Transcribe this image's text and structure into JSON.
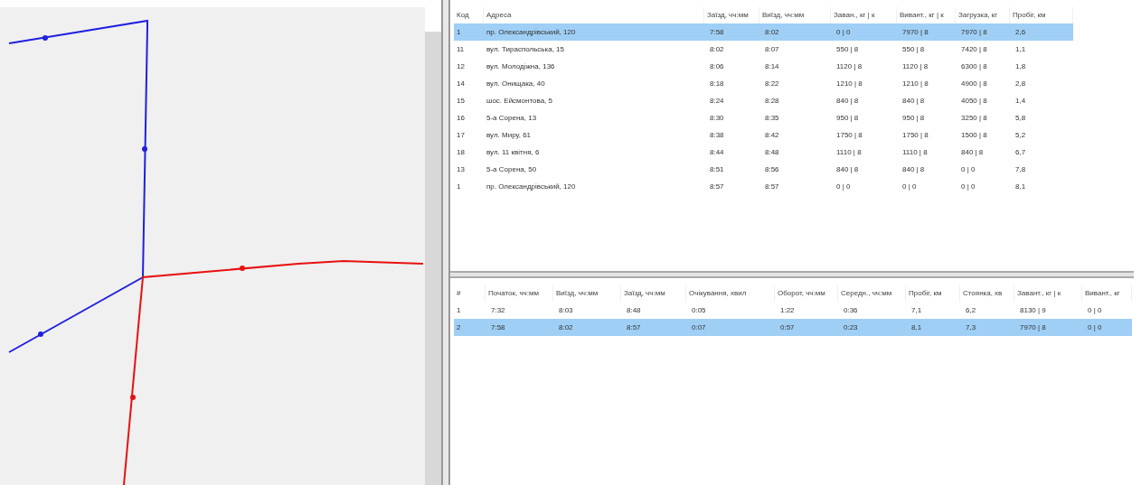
{
  "map": {
    "routes": [
      {
        "color": "#2020e0"
      },
      {
        "color": "#e81010"
      }
    ]
  },
  "stops_table": {
    "columns": [
      "Код",
      "Адреса",
      "Заїзд, чч:мм",
      "Виїзд, чч:мм",
      "Заван., кг | к",
      "Вивант., кг | к",
      "Загрузка, кг",
      "Пробіг, км"
    ],
    "rows": [
      {
        "cells": [
          "1",
          "пр. Олександрівський, 120",
          "7:58",
          "8:02",
          "0 | 0",
          "7970 | 8",
          "7970 | 8",
          "2,6"
        ],
        "selected": true
      },
      {
        "cells": [
          "11",
          "вул. Тираспольська, 15",
          "8:02",
          "8:07",
          "550 | 8",
          "550 | 8",
          "7420 | 8",
          "1,1"
        ],
        "selected": false
      },
      {
        "cells": [
          "12",
          "вул. Молодіжна, 136",
          "8:06",
          "8:14",
          "1120 | 8",
          "1120 | 8",
          "6300 | 8",
          "1,8"
        ],
        "selected": false
      },
      {
        "cells": [
          "14",
          "вул. Онищака, 40",
          "8:18",
          "8:22",
          "1210 | 8",
          "1210 | 8",
          "4900 | 8",
          "2,8"
        ],
        "selected": false
      },
      {
        "cells": [
          "15",
          "шос. Ейсмонтова, 5",
          "8:24",
          "8:28",
          "840 | 8",
          "840 | 8",
          "4050 | 8",
          "1,4"
        ],
        "selected": false
      },
      {
        "cells": [
          "16",
          "5-а Сорена, 13",
          "8:30",
          "8:35",
          "950 | 8",
          "950 | 8",
          "3250 | 8",
          "5,8"
        ],
        "selected": false
      },
      {
        "cells": [
          "17",
          "вул. Миру, 61",
          "8:38",
          "8:42",
          "1750 | 8",
          "1750 | 8",
          "1500 | 8",
          "5,2"
        ],
        "selected": false
      },
      {
        "cells": [
          "18",
          "вул. 11 квітня, 6",
          "8:44",
          "8:48",
          "1110 | 8",
          "1110 | 8",
          "840 | 8",
          "6,7"
        ],
        "selected": false
      },
      {
        "cells": [
          "13",
          "5-а Сорена, 50",
          "8:51",
          "8:56",
          "840 | 8",
          "840 | 8",
          "0 | 0",
          "7,8"
        ],
        "selected": false
      },
      {
        "cells": [
          "1",
          "пр. Олександрівський, 120",
          "8:57",
          "8:57",
          "0 | 0",
          "0 | 0",
          "0 | 0",
          "8,1"
        ],
        "selected": false
      }
    ]
  },
  "trips_table": {
    "columns": [
      "#",
      "Початок, чч:мм",
      "Виїзд, чч:мм",
      "Заїзд, чч:мм",
      "Очікування, хвил",
      "Оборот, чч:мм",
      "Середн., чч:мм",
      "Пробіг, км",
      "Стоянка, хв",
      "Завант., кг | к",
      "Вивант., кг"
    ],
    "rows": [
      {
        "cells": [
          "1",
          "7:32",
          "8:03",
          "8:48",
          "0:05",
          "1:22",
          "0:36",
          "7,1",
          "6,2",
          "8130 | 9",
          "0 | 0"
        ],
        "selected": false
      },
      {
        "cells": [
          "2",
          "7:58",
          "8:02",
          "8:57",
          "0:07",
          "0:57",
          "0:23",
          "8,1",
          "7,3",
          "7970 | 8",
          "0 | 0"
        ],
        "selected": true
      }
    ]
  }
}
